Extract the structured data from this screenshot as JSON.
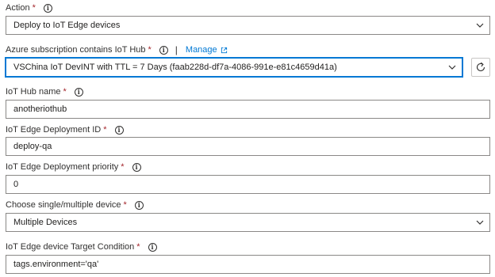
{
  "fields": {
    "action": {
      "label": "Action",
      "required": "*",
      "value": "Deploy to IoT Edge devices"
    },
    "subscription": {
      "label": "Azure subscription contains IoT Hub",
      "required": "*",
      "separator": "|",
      "manage_link": "Manage",
      "value": "VSChina IoT DevINT with TTL = 7 Days (faab228d-df7a-4086-991e-e81c4659d41a)"
    },
    "hub_name": {
      "label": "IoT Hub name",
      "required": "*",
      "value": "anotheriothub"
    },
    "deployment_id": {
      "label": "IoT Edge Deployment ID",
      "required": "*",
      "value": "deploy-qa"
    },
    "deployment_priority": {
      "label": "IoT Edge Deployment priority",
      "required": "*",
      "value": "0"
    },
    "device_choice": {
      "label": "Choose single/multiple device",
      "required": "*",
      "value": "Multiple Devices"
    },
    "target_condition": {
      "label": "IoT Edge device Target Condition",
      "required": "*",
      "value": "tags.environment='qa'"
    }
  },
  "icons": {
    "info": "info-icon",
    "external_link": "external-link-icon",
    "chevron": "chevron-down-icon",
    "refresh": "refresh-icon"
  },
  "colors": {
    "accent": "#0078d4",
    "required": "#a4262c",
    "border": "#8a8886"
  }
}
